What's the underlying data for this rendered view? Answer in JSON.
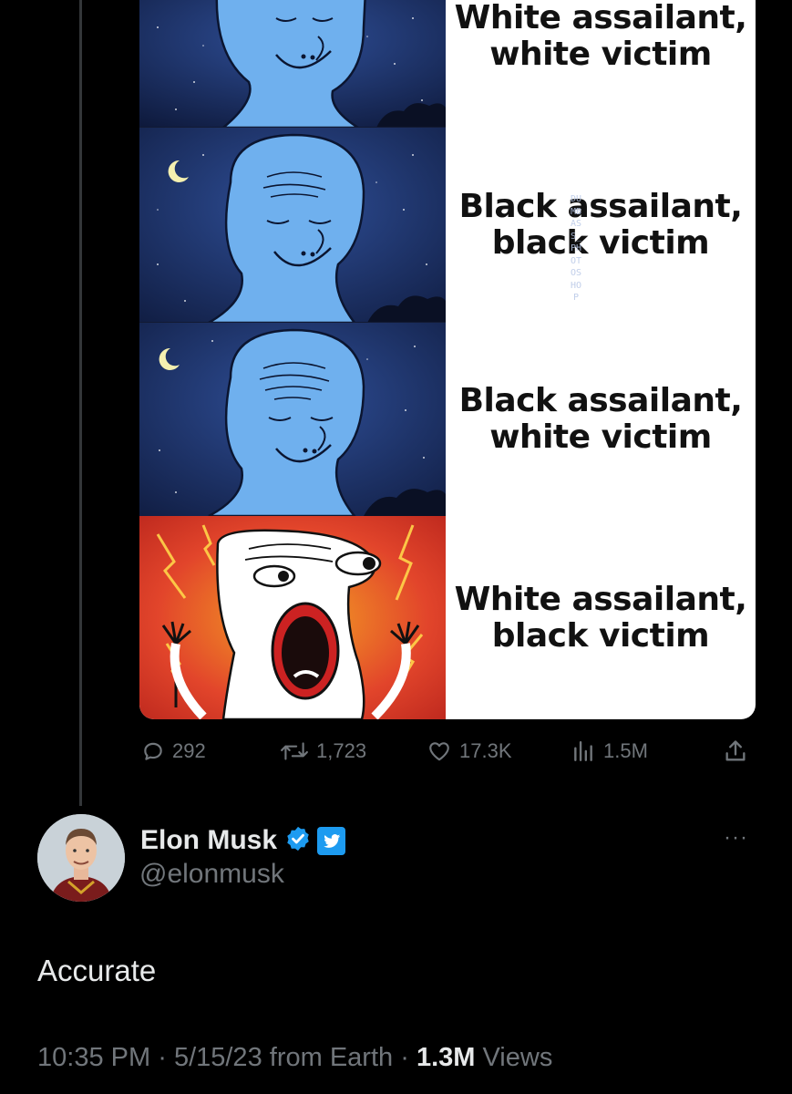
{
  "meme": {
    "panels": [
      {
        "caption": "White assailant,\nwhite victim"
      },
      {
        "caption": "Black assailant,\nblack victim"
      },
      {
        "caption": "Black assailant,\nwhite victim"
      },
      {
        "caption": "White assailant,\nblack victim"
      }
    ],
    "watermark": "DUMBASS_PHOTOSHOP"
  },
  "original_tweet": {
    "actions": {
      "replies": "292",
      "retweets": "1,723",
      "likes": "17.3K",
      "views": "1.5M"
    }
  },
  "reply": {
    "author": {
      "display_name": "Elon Musk",
      "handle": "@elonmusk",
      "verified": true,
      "badge_icon": "twitter-bird-icon"
    },
    "more_icon": "···",
    "text": "Accurate",
    "meta": {
      "time": "10:35 PM",
      "separator": "·",
      "date": "5/15/23",
      "source": "from Earth",
      "views_count": "1.3M",
      "views_label": "Views"
    }
  },
  "colors": {
    "background": "#000000",
    "text_primary": "#e7e9ea",
    "text_secondary": "#71767b",
    "brand_blue": "#1d9bf0",
    "thread_line": "#333639"
  }
}
